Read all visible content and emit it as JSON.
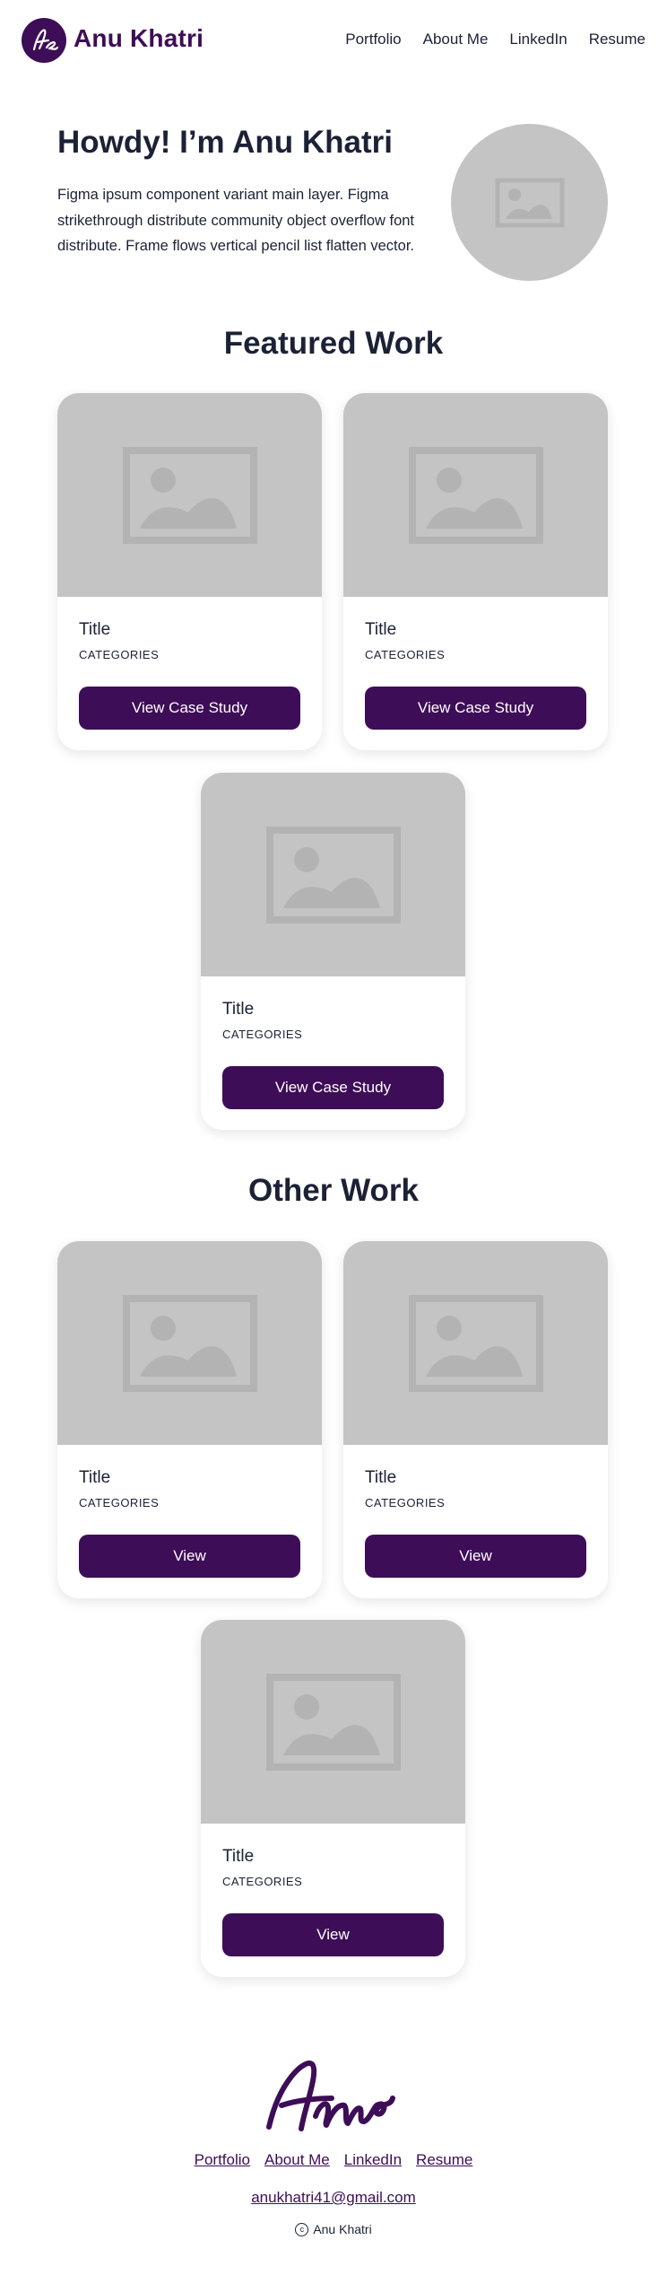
{
  "header": {
    "logo_name": "Anu Khatri",
    "nav": [
      "Portfolio",
      "About Me",
      "LinkedIn",
      "Resume"
    ]
  },
  "hero": {
    "title": "Howdy! I’m Anu Khatri",
    "text": "Figma ipsum component variant main layer. Figma strikethrough distribute community object overflow font distribute. Frame flows vertical pencil list flatten vector."
  },
  "featured": {
    "title": "Featured Work",
    "cards": [
      {
        "title": "Title",
        "category": "CATEGORIES",
        "button": "View Case Study"
      },
      {
        "title": "Title",
        "category": "CATEGORIES",
        "button": "View Case Study"
      },
      {
        "title": "Title",
        "category": "CATEGORIES",
        "button": "View Case Study"
      }
    ]
  },
  "other": {
    "title": "Other Work",
    "cards": [
      {
        "title": "Title",
        "category": "CATEGORIES",
        "button": "View"
      },
      {
        "title": "Title",
        "category": "CATEGORIES",
        "button": "View"
      },
      {
        "title": "Title",
        "category": "CATEGORIES",
        "button": "View"
      }
    ]
  },
  "footer": {
    "signature": "Anu",
    "links": [
      "Portfolio",
      "About Me",
      "LinkedIn",
      "Resume"
    ],
    "email": "anukhatri41@gmail.com",
    "copyright_symbol": "c",
    "copyright_name": "Anu Khatri"
  },
  "colors": {
    "brand": "#3e0d57",
    "text": "#1b2236",
    "placeholder": "#c4c4c4",
    "placeholder_icon": "#b3b3b3"
  },
  "icons": {
    "logo": "signature-logo-icon",
    "placeholder": "image-placeholder-icon",
    "copyright": "copyright-icon"
  }
}
